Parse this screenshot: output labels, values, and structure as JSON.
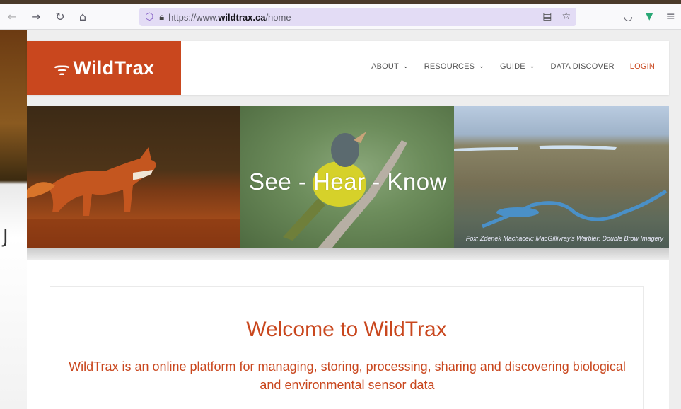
{
  "browser": {
    "url_prefix": "https://www.",
    "url_domain": "wildtrax.ca",
    "url_path": "/home",
    "icons": [
      "back-icon",
      "forward-icon",
      "reload-icon",
      "home-icon",
      "shield-icon",
      "lock-icon",
      "reader-view-icon",
      "bookmark-star-icon",
      "pocket-icon",
      "vue-devtools-icon",
      "menu-icon"
    ]
  },
  "site": {
    "logo_text": "WildTrax",
    "nav": [
      {
        "label": "ABOUT",
        "dropdown": true
      },
      {
        "label": "RESOURCES",
        "dropdown": true
      },
      {
        "label": "GUIDE",
        "dropdown": true
      },
      {
        "label": "DATA DISCOVER",
        "dropdown": false
      },
      {
        "label": "LOGIN",
        "dropdown": false
      }
    ],
    "brand_color": "#c9471e"
  },
  "hero": {
    "headline": "See - Hear - Know",
    "credit": "Fox: Zdenek Machacek; MacGillivray's Warbler: Double Brow Imagery"
  },
  "welcome": {
    "title": "Welcome to WildTrax",
    "tagline": "WildTrax is an online platform for managing, storing, processing, sharing and discovering biological and environmental sensor data"
  }
}
